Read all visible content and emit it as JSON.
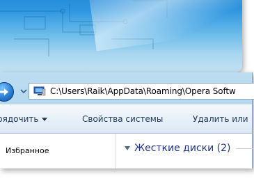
{
  "address_bar": {
    "path": "C:\\Users\\Raik\\AppData\\Roaming\\Opera Softw"
  },
  "toolbar": {
    "organize_label": "рядочить",
    "system_properties_label": "Свойства системы",
    "uninstall_label": "Удалить или"
  },
  "navigation_pane": {
    "favorites_label": "Избранное"
  },
  "content": {
    "group_header": "Жесткие диски (2)"
  },
  "icons": {
    "back": "forward-arrow-icon",
    "dropdown": "chevron-down-icon",
    "location": "computer-icon",
    "collapse": "triangle-down-icon"
  },
  "colors": {
    "glass_top": "#1f86d6",
    "toolbar_text": "#1e395b",
    "group_header_text": "#1e3287"
  }
}
